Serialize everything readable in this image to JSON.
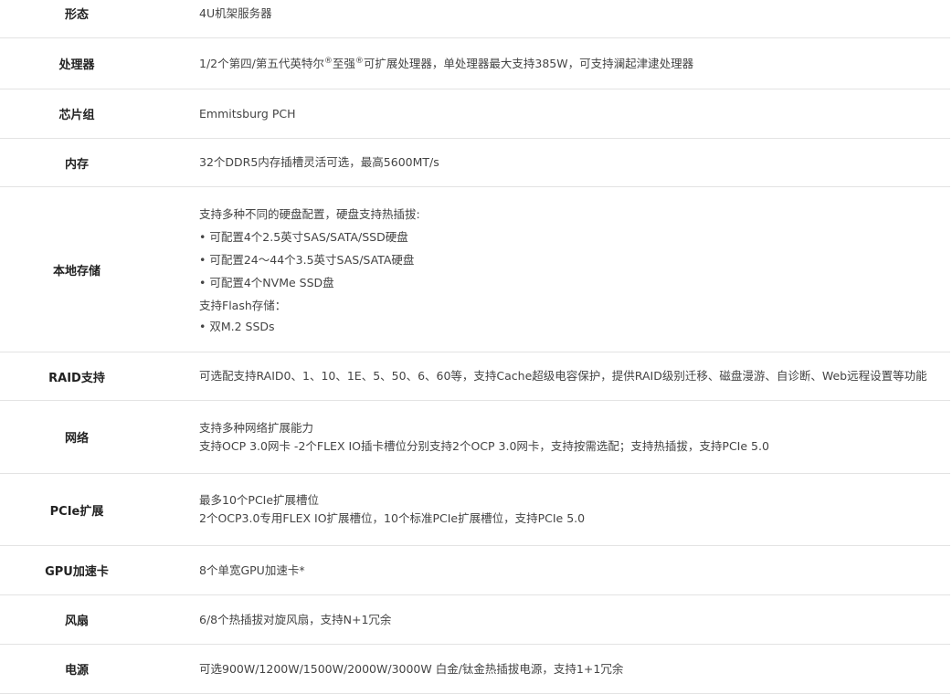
{
  "rows": [
    {
      "label": "形态",
      "lines": [
        "4U机架服务器"
      ]
    },
    {
      "label": "处理器",
      "cpu": {
        "pre": "1/2个第四/第五代英特尔",
        "sup1": "®",
        "mid": "至强",
        "sup2": "®",
        "post": "可扩展处理器，单处理器最大支持385W，可支持澜起津逮处理器"
      }
    },
    {
      "label": "芯片组",
      "lines": [
        "Emmitsburg PCH"
      ]
    },
    {
      "label": "内存",
      "lines": [
        "32个DDR5内存插槽灵活可选，最高5600MT/s"
      ]
    },
    {
      "label": "本地存储",
      "lines": [
        "支持多种不同的硬盘配置，硬盘支持热插拔:",
        "• 可配置4个2.5英寸SAS/SATA/SSD硬盘",
        "• 可配置24～44个3.5英寸SAS/SATA硬盘",
        "• 可配置4个NVMe SSD盘",
        "支持Flash存储：",
        "• 双M.2 SSDs"
      ]
    },
    {
      "label": "RAID支持",
      "lines": [
        "可选配支持RAID0、1、10、1E、5、50、6、60等，支持Cache超级电容保护，提供RAID级别迁移、磁盘漫游、自诊断、Web远程设置等功能"
      ]
    },
    {
      "label": "网络",
      "lines": [
        "支持多种网络扩展能力",
        "支持OCP 3.0网卡 -2个FLEX IO插卡槽位分别支持2个OCP 3.0网卡，支持按需选配；支持热插拔，支持PCIe 5.0"
      ]
    },
    {
      "label": "PCIe扩展",
      "lines": [
        "最多10个PCIe扩展槽位",
        "2个OCP3.0专用FLEX IO扩展槽位，10个标准PCIe扩展槽位，支持PCIe 5.0"
      ]
    },
    {
      "label": "GPU加速卡",
      "lines": [
        "8个单宽GPU加速卡*"
      ]
    },
    {
      "label": "风扇",
      "lines": [
        "6/8个热插拔对旋风扇，支持N+1冗余"
      ]
    },
    {
      "label": "电源",
      "lines": [
        "可选900W/1200W/1500W/2000W/3000W 白金/钛金热插拔电源，支持1+1冗余"
      ]
    }
  ]
}
